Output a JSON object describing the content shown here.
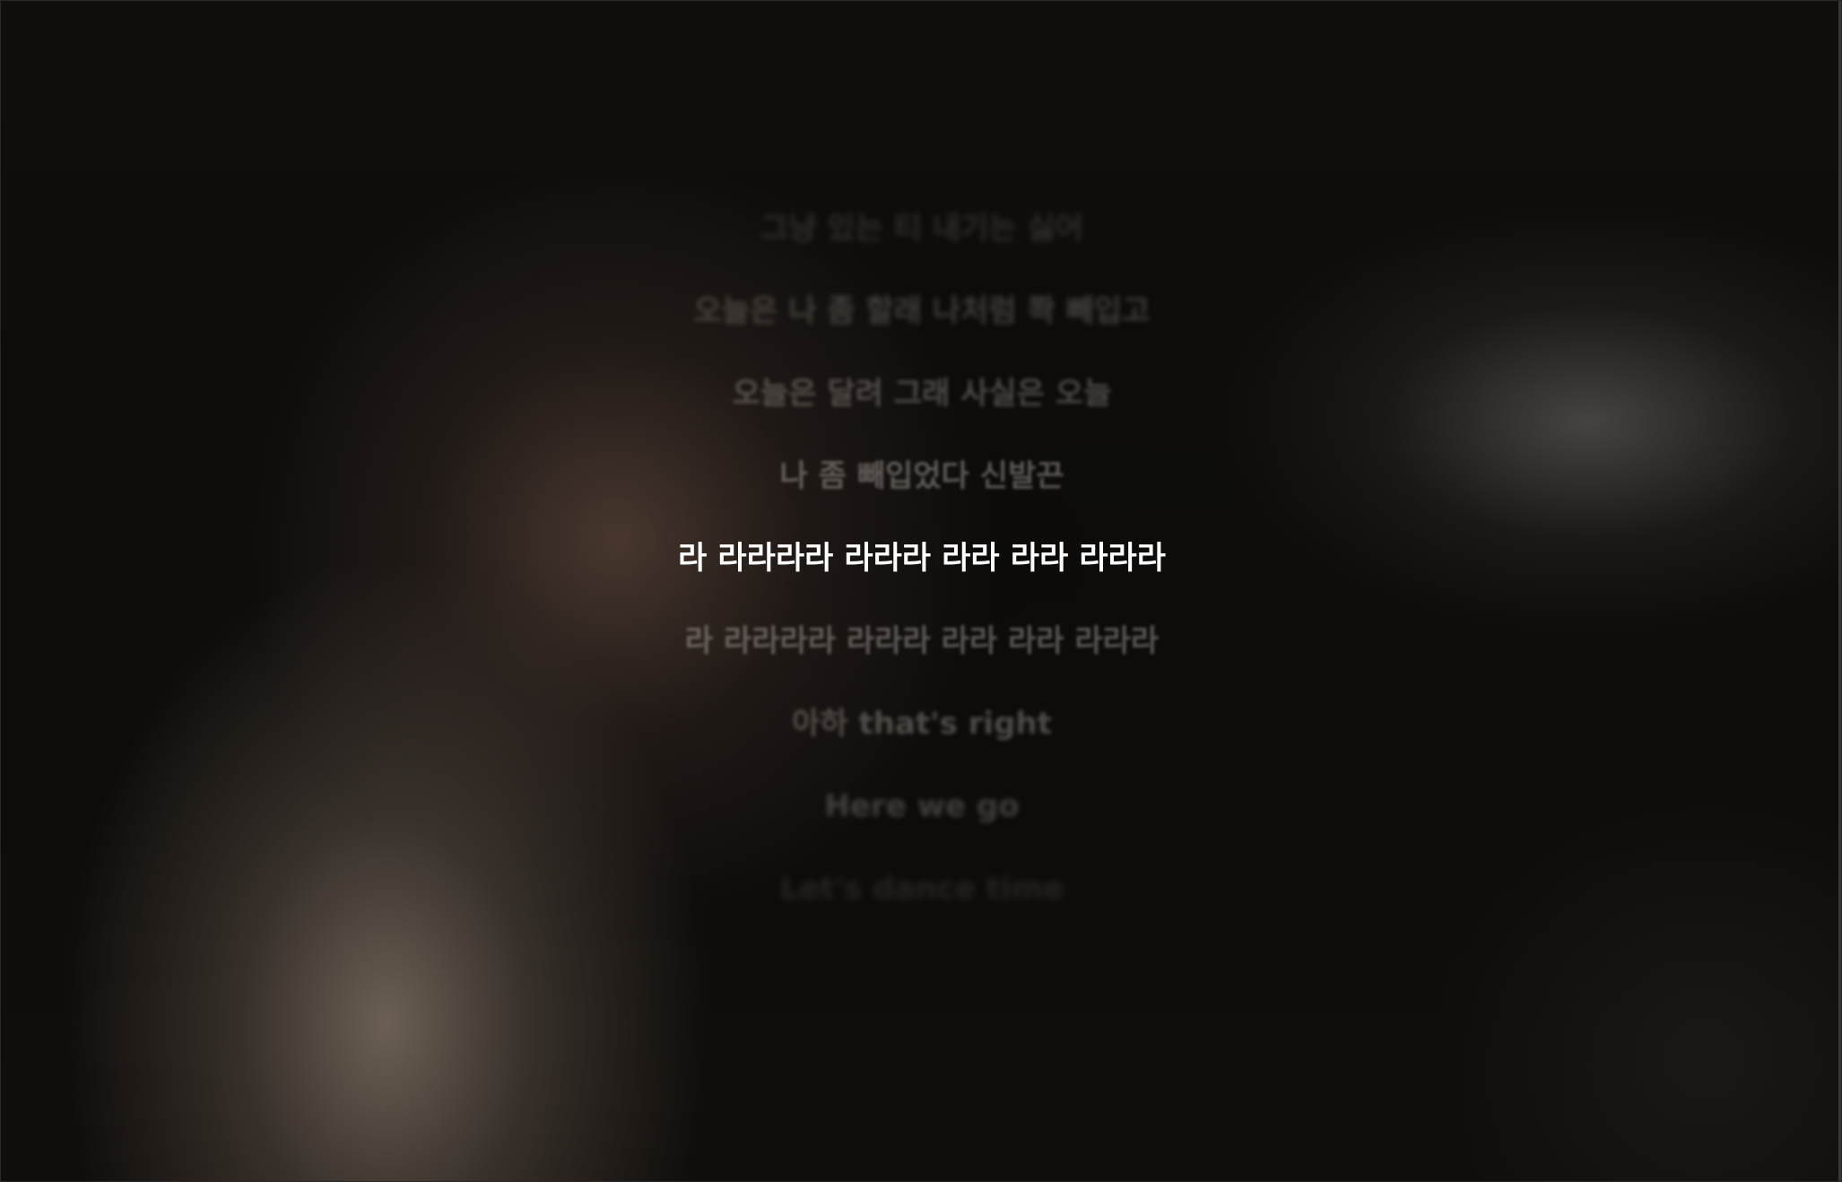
{
  "lyrics": {
    "lines": [
      {
        "text": "그냥 있는 티 내기는 싫어"
      },
      {
        "text": "오늘은 나 좀 할래 나처럼 쫙 빼입고"
      },
      {
        "text": "오늘은 달려 그래 사실은 오늘"
      },
      {
        "text": "나 좀 빼입었다 신발끈"
      },
      {
        "text": "라 라라라라 라라라 라라 라라 라라라"
      },
      {
        "text": "라 라라라라 라라라 라라 라라 라라라"
      },
      {
        "text": "아하 that's right"
      },
      {
        "text": "Here we go"
      },
      {
        "text": "Let's dance time"
      }
    ],
    "current_index": 4
  },
  "colors": {
    "current_line": "#ffffff",
    "dim_line": "#c8c3be",
    "background": "#0d0c0b"
  }
}
